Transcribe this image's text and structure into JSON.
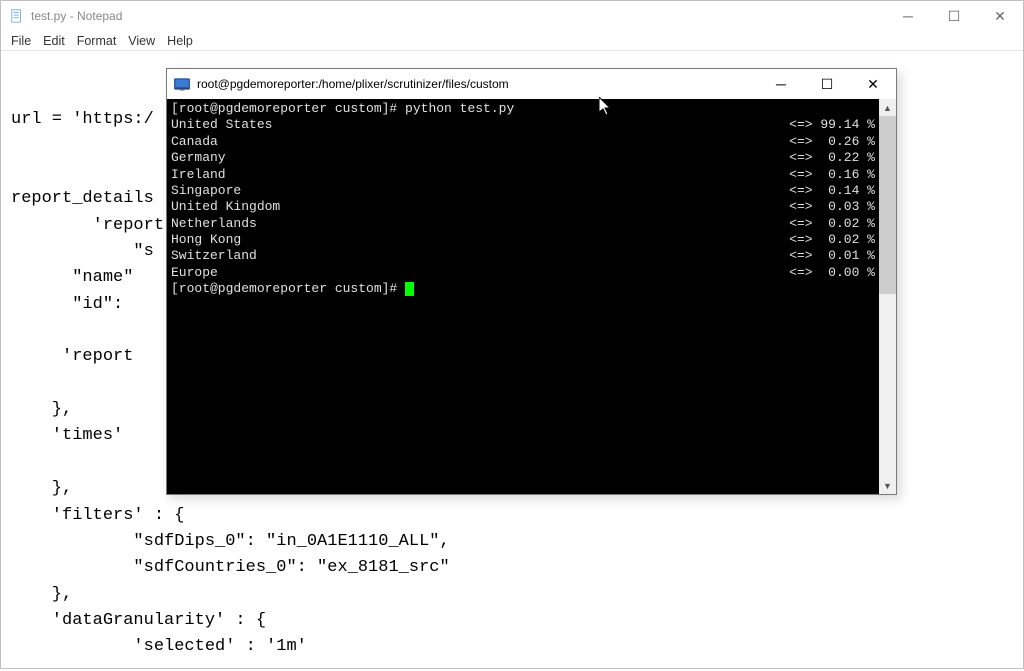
{
  "notepad": {
    "title": "test.py - Notepad",
    "menu": [
      "File",
      "Edit",
      "Format",
      "View",
      "Help"
    ],
    "code_lines": [
      "",
      "url = 'https:/",
      "",
      "",
      "report_details",
      "        'report",
      "            \"s",
      "      \"name\"",
      "      \"id\":",
      "",
      "     'report",
      "",
      "    },",
      "    'times'",
      "",
      "    },",
      "    'filters' : {",
      "            \"sdfDips_0\": \"in_0A1E1110_ALL\",",
      "            \"sdfCountries_0\": \"ex_8181_src\"",
      "    },",
      "    'dataGranularity' : {",
      "            'selected' : '1m'"
    ]
  },
  "terminal": {
    "title": "root@pgdemoreporter:/home/plixer/scrutinizer/files/custom",
    "prompt_cmd": "[root@pgdemoreporter custom]# python test.py",
    "prompt_idle": "[root@pgdemoreporter custom]# ",
    "rows": [
      {
        "name": "United States",
        "value": "<=> 99.14 %"
      },
      {
        "name": "Canada",
        "value": "<=>  0.26 %"
      },
      {
        "name": "Germany",
        "value": "<=>  0.22 %"
      },
      {
        "name": "Ireland",
        "value": "<=>  0.16 %"
      },
      {
        "name": "Singapore",
        "value": "<=>  0.14 %"
      },
      {
        "name": "United Kingdom",
        "value": "<=>  0.03 %"
      },
      {
        "name": "Netherlands",
        "value": "<=>  0.02 %"
      },
      {
        "name": "Hong Kong",
        "value": "<=>  0.02 %"
      },
      {
        "name": "Switzerland",
        "value": "<=>  0.01 %"
      },
      {
        "name": "Europe",
        "value": "<=>  0.00 %"
      }
    ]
  }
}
